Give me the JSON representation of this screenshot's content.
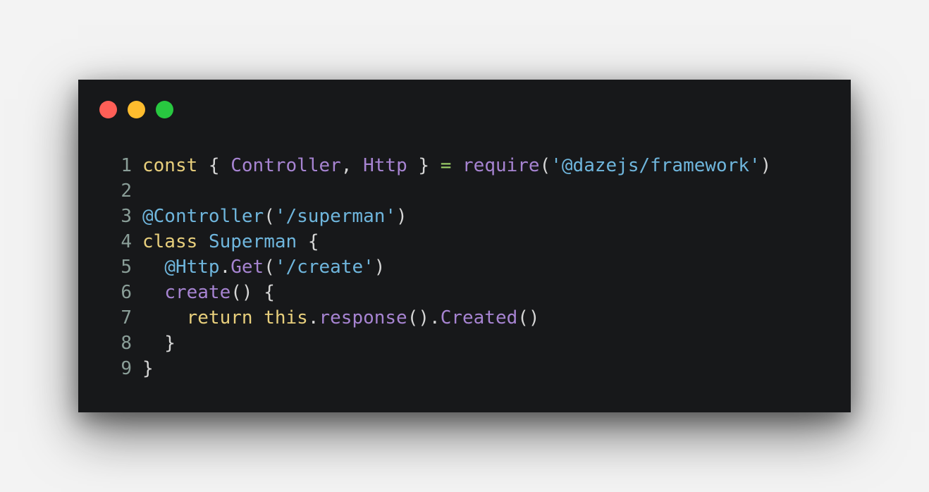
{
  "window": {
    "controls": [
      "close",
      "minimize",
      "zoom"
    ]
  },
  "code": {
    "lines": [
      {
        "number": "1",
        "tokens": [
          {
            "t": "const",
            "c": "kw"
          },
          {
            "t": " { ",
            "c": "pun"
          },
          {
            "t": "Controller",
            "c": "cls"
          },
          {
            "t": ", ",
            "c": "pun"
          },
          {
            "t": "Http",
            "c": "cls"
          },
          {
            "t": " } ",
            "c": "pun"
          },
          {
            "t": "=",
            "c": "op"
          },
          {
            "t": " ",
            "c": "pun"
          },
          {
            "t": "require",
            "c": "fn"
          },
          {
            "t": "(",
            "c": "pun"
          },
          {
            "t": "'@dazejs/framework'",
            "c": "str"
          },
          {
            "t": ")",
            "c": "pun"
          }
        ]
      },
      {
        "number": "2",
        "tokens": []
      },
      {
        "number": "3",
        "tokens": [
          {
            "t": "@Controller",
            "c": "dec"
          },
          {
            "t": "(",
            "c": "pun"
          },
          {
            "t": "'/superman'",
            "c": "str"
          },
          {
            "t": ")",
            "c": "pun"
          }
        ]
      },
      {
        "number": "4",
        "tokens": [
          {
            "t": "class",
            "c": "kw"
          },
          {
            "t": " ",
            "c": "pun"
          },
          {
            "t": "Superman",
            "c": "str"
          },
          {
            "t": " {",
            "c": "pun"
          }
        ]
      },
      {
        "number": "5",
        "tokens": [
          {
            "t": "  ",
            "c": "pun"
          },
          {
            "t": "@Http",
            "c": "dec"
          },
          {
            "t": ".",
            "c": "pun"
          },
          {
            "t": "Get",
            "c": "fn"
          },
          {
            "t": "(",
            "c": "pun"
          },
          {
            "t": "'/create'",
            "c": "str"
          },
          {
            "t": ")",
            "c": "pun"
          }
        ]
      },
      {
        "number": "6",
        "tokens": [
          {
            "t": "  ",
            "c": "pun"
          },
          {
            "t": "create",
            "c": "fn"
          },
          {
            "t": "() {",
            "c": "pun"
          }
        ]
      },
      {
        "number": "7",
        "tokens": [
          {
            "t": "    ",
            "c": "pun"
          },
          {
            "t": "return",
            "c": "kw"
          },
          {
            "t": " ",
            "c": "pun"
          },
          {
            "t": "this",
            "c": "kw"
          },
          {
            "t": ".",
            "c": "pun"
          },
          {
            "t": "response",
            "c": "fn"
          },
          {
            "t": "().",
            "c": "pun"
          },
          {
            "t": "Created",
            "c": "fn"
          },
          {
            "t": "()",
            "c": "pun"
          }
        ]
      },
      {
        "number": "8",
        "tokens": [
          {
            "t": "  }",
            "c": "pun"
          }
        ]
      },
      {
        "number": "9",
        "tokens": [
          {
            "t": "}",
            "c": "pun"
          }
        ]
      }
    ]
  }
}
